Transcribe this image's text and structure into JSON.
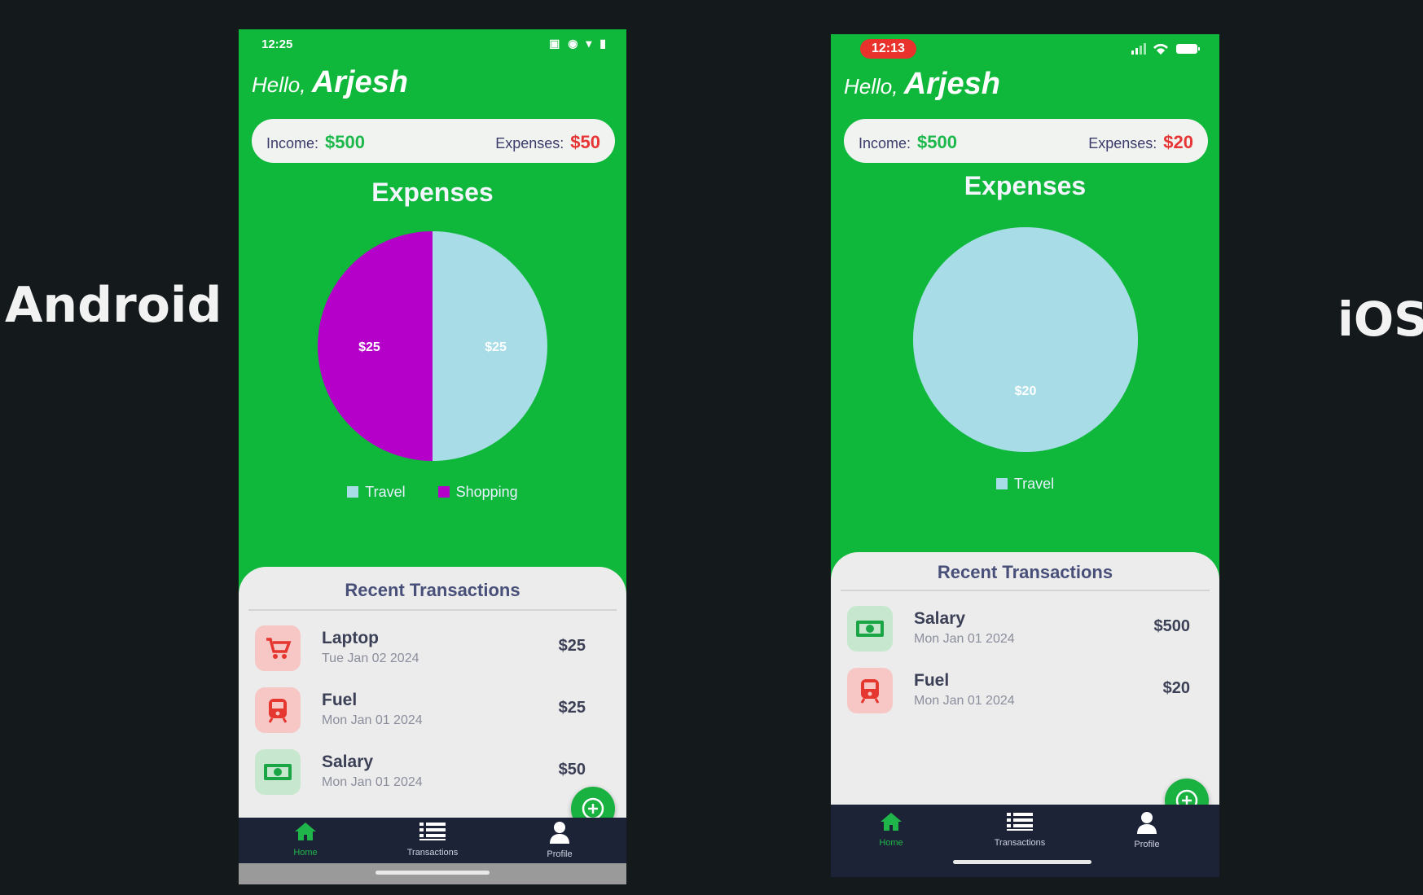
{
  "labels": {
    "android": "Android",
    "ios": "iOS"
  },
  "android": {
    "time": "12:25",
    "status_icons_text": "▣ ◉ ▾ ▮",
    "greeting": {
      "hello": "Hello, ",
      "name": "Arjesh"
    },
    "summary": {
      "income_label": "Income:",
      "income_value": "$500",
      "expenses_label": "Expenses:",
      "expenses_value": "$50"
    },
    "chart_title": "Expenses",
    "chart_data": {
      "type": "pie",
      "slices": [
        {
          "label": "Travel",
          "value": 25,
          "display": "$25",
          "color": "#a8dde8"
        },
        {
          "label": "Shopping",
          "value": 25,
          "display": "$25",
          "color": "#b400c8"
        }
      ]
    },
    "legend": [
      {
        "label": "Travel",
        "color": "#a8dde8"
      },
      {
        "label": "Shopping",
        "color": "#b400c8"
      }
    ],
    "recent_title": "Recent Transactions",
    "transactions": [
      {
        "name": "Laptop",
        "date": "Tue Jan 02 2024",
        "amount": "$25",
        "icon": "cart-icon"
      },
      {
        "name": "Fuel",
        "date": "Mon Jan 01 2024",
        "amount": "$25",
        "icon": "train-icon"
      },
      {
        "name": "Salary",
        "date": "Mon Jan 01 2024",
        "amount": "$50",
        "icon": "money-icon"
      }
    ],
    "nav": {
      "home": "Home",
      "transactions": "Transactions",
      "profile": "Profile"
    }
  },
  "ios": {
    "time": "12:13",
    "greeting": {
      "hello": "Hello, ",
      "name": "Arjesh"
    },
    "summary": {
      "income_label": "Income:",
      "income_value": "$500",
      "expenses_label": "Expenses:",
      "expenses_value": "$20"
    },
    "chart_title": "Expenses",
    "chart_data": {
      "type": "pie",
      "slices": [
        {
          "label": "Travel",
          "value": 20,
          "display": "$20",
          "color": "#a8dde8"
        }
      ]
    },
    "legend": [
      {
        "label": "Travel",
        "color": "#a8dde8"
      }
    ],
    "recent_title": "Recent Transactions",
    "transactions": [
      {
        "name": "Salary",
        "date": "Mon Jan 01 2024",
        "amount": "$500",
        "icon": "money-icon"
      },
      {
        "name": "Fuel",
        "date": "Mon Jan 01 2024",
        "amount": "$20",
        "icon": "train-icon"
      }
    ],
    "nav": {
      "home": "Home",
      "transactions": "Transactions",
      "profile": "Profile"
    }
  },
  "colors": {
    "app_green": "#0fb83a",
    "income_green": "#1db84b",
    "expense_red": "#e73434",
    "nav_dark": "#1d2337"
  }
}
